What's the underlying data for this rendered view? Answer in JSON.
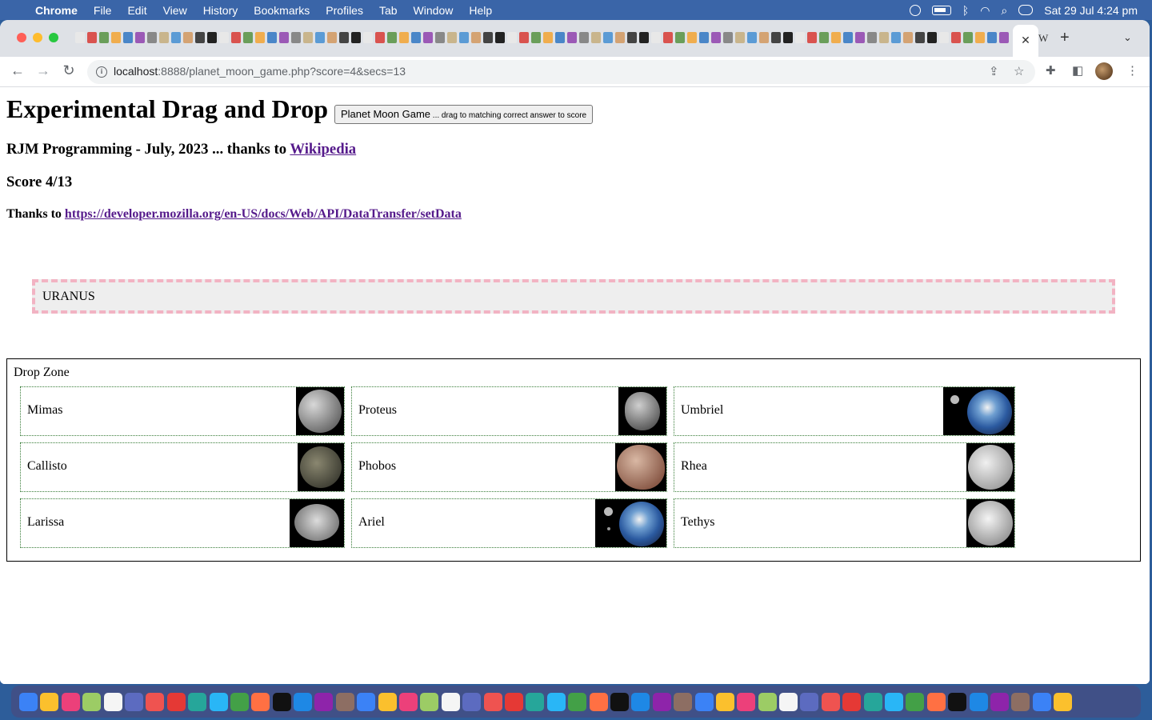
{
  "menubar": {
    "app_name": "Chrome",
    "items": [
      "File",
      "Edit",
      "View",
      "History",
      "Bookmarks",
      "Profiles",
      "Tab",
      "Window",
      "Help"
    ],
    "clock": "Sat 29 Jul  4:24 pm"
  },
  "browser": {
    "url_host": "localhost",
    "url_path": ":8888/planet_moon_game.php?score=4&secs=13",
    "trailing_tab_label": "W"
  },
  "page": {
    "heading": "Experimental Drag and Drop",
    "button_label": "Planet Moon Game",
    "button_hint": " ... drag to matching correct answer to score",
    "credit_text": "RJM Programming - July, 2023 ... thanks to ",
    "credit_link": "Wikipedia",
    "score": "Score 4/13",
    "thanks_text": "Thanks to ",
    "thanks_link": "https://developer.mozilla.org/en-US/docs/Web/API/DataTransfer/setData",
    "draggable_planet": "URANUS",
    "drop_zone_label": "Drop Zone",
    "moons": [
      {
        "name": "Mimas",
        "image": "mimas-moon-image"
      },
      {
        "name": "Proteus",
        "image": "proteus-moon-image"
      },
      {
        "name": "Umbriel",
        "image": "earth-and-moon-image"
      },
      {
        "name": "Callisto",
        "image": "callisto-moon-image"
      },
      {
        "name": "Phobos",
        "image": "phobos-moon-image"
      },
      {
        "name": "Rhea",
        "image": "rhea-moon-image"
      },
      {
        "name": "Larissa",
        "image": "larissa-moon-image"
      },
      {
        "name": "Ariel",
        "image": "earth-and-moon-image"
      },
      {
        "name": "Tethys",
        "image": "tethys-moon-image"
      }
    ]
  },
  "colors": {
    "drop_border": "#f2b3c3",
    "cell_border": "#3a7d3a",
    "link": "#551a8b"
  }
}
